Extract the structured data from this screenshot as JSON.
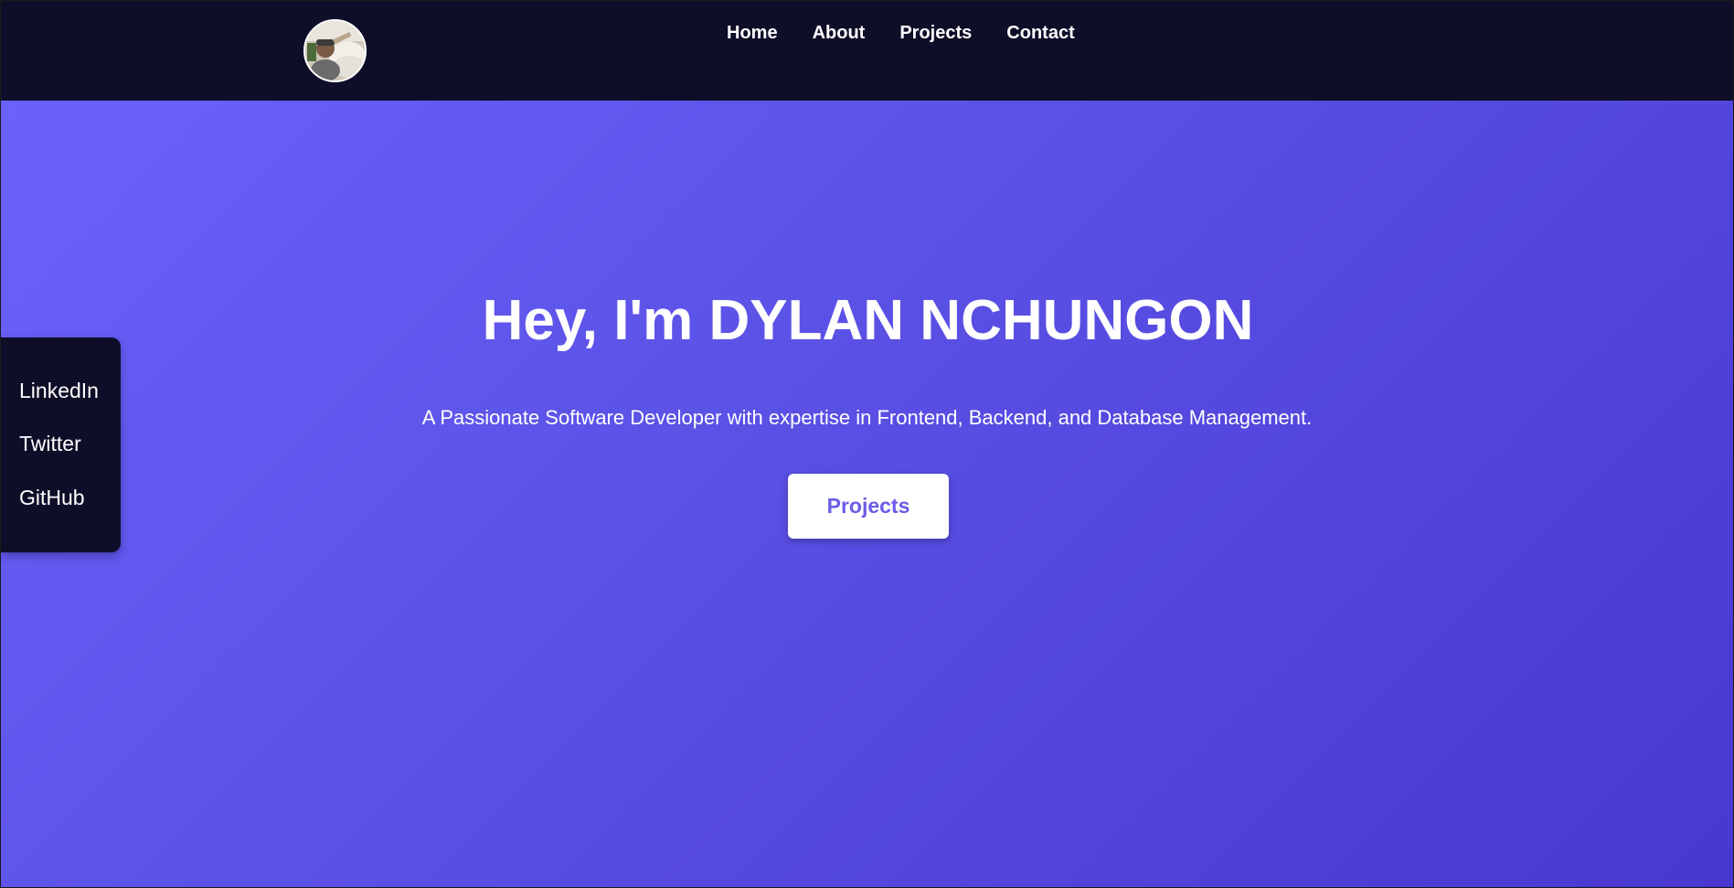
{
  "nav": {
    "links": [
      "Home",
      "About",
      "Projects",
      "Contact"
    ]
  },
  "hero": {
    "title": "Hey, I'm DYLAN NCHUNGON",
    "subtitle": "A Passionate Software Developer with expertise in Frontend, Backend, and Database Management.",
    "button_label": "Projects"
  },
  "social": {
    "links": [
      "LinkedIn",
      "Twitter",
      "GitHub"
    ]
  },
  "colors": {
    "navbar_bg": "#0f0e29",
    "hero_gradient_start": "#6b61fd",
    "hero_gradient_end": "#4838d0",
    "button_text": "#6a5ce6",
    "text": "#ffffff"
  }
}
